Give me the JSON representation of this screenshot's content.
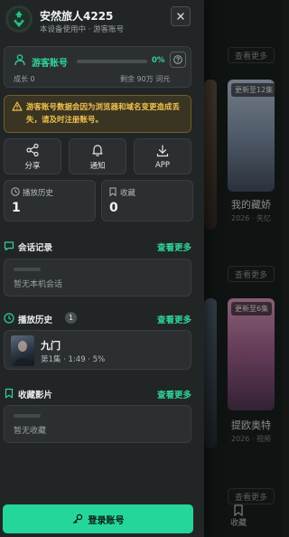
{
  "user": {
    "name": "安然旅人4225",
    "subtitle": "本设备使用中 · 游客账号"
  },
  "guest": {
    "label": "游客账号",
    "progress_pct": 0,
    "progress_text": "0%",
    "growth": "成长 0",
    "remaining": "剩余 90万 词元"
  },
  "warning": {
    "text": "游客账号数据会因为浏览器和域名变更造成丢失，请及时注册账号。"
  },
  "actions": [
    {
      "label": "分享",
      "icon": "share-icon"
    },
    {
      "label": "通知",
      "icon": "bell-icon"
    },
    {
      "label": "APP",
      "icon": "download-icon"
    }
  ],
  "stats": [
    {
      "label": "播放历史",
      "value": "1",
      "icon": "clock-icon"
    },
    {
      "label": "收藏",
      "value": "0",
      "icon": "bookmark-icon"
    }
  ],
  "sections": {
    "chats": {
      "title": "会话记录",
      "more": "查看更多",
      "empty": "暂无本机会话"
    },
    "history": {
      "title": "播放历史",
      "count": "1",
      "more": "查看更多",
      "item": {
        "title": "九门",
        "meta": "第1集 · 1:49 · 5%"
      }
    },
    "favorites": {
      "title": "收藏影片",
      "more": "查看更多",
      "empty": "暂无收藏"
    }
  },
  "login_label": "登录账号",
  "background": {
    "more_label": "查看更多",
    "tag1": "更新至12集",
    "tag2": "更新至6集",
    "title1": "我的藏娇",
    "sub1": "2026 · 失忆",
    "title2": "提欧奥特",
    "sub2": "2026 · 视频",
    "fav_label": "收藏"
  },
  "colors": {
    "accent": "#24d69a",
    "warning_text": "#f0c24e",
    "drawer_bg": "#222526"
  }
}
